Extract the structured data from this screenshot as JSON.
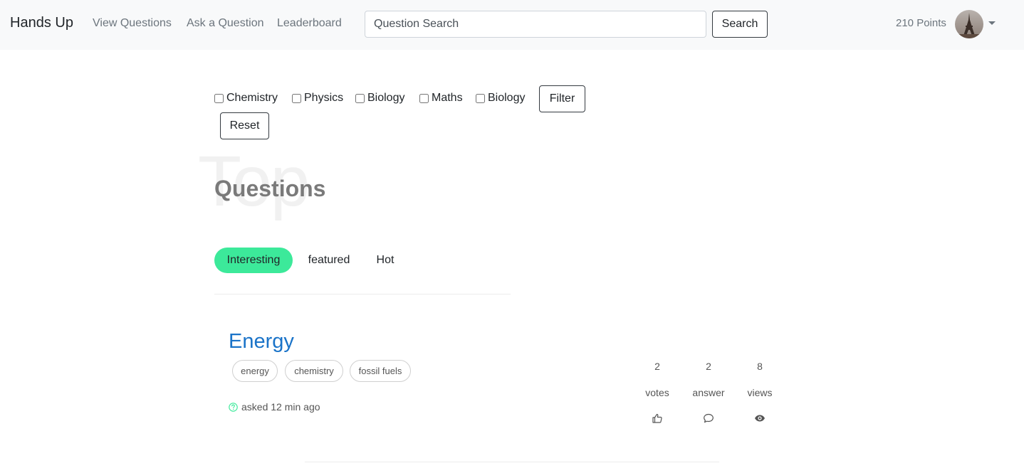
{
  "navbar": {
    "brand": "Hands Up",
    "links": [
      "View Questions",
      "Ask a Question",
      "Leaderboard"
    ],
    "search_placeholder": "Question Search",
    "search_button": "Search",
    "points": "210 Points"
  },
  "filters": {
    "subjects": [
      "Chemistry",
      "Physics",
      "Biology",
      "Maths",
      "Biology"
    ],
    "filter_button": "Filter",
    "reset_button": "Reset"
  },
  "heading": {
    "background_word": "Top",
    "title": "Questions"
  },
  "tabs": [
    {
      "label": "Interesting",
      "active": true
    },
    {
      "label": "featured",
      "active": false
    },
    {
      "label": "Hot",
      "active": false
    }
  ],
  "question": {
    "title": "Energy",
    "tags": [
      "energy",
      "chemistry",
      "fossil fuels"
    ],
    "asked": "asked 12 min ago",
    "stats": {
      "votes_count": "2",
      "votes_label": "votes",
      "answers_count": "2",
      "answers_label": "answer",
      "views_count": "8",
      "views_label": "views"
    }
  },
  "colors": {
    "accent": "#3ce99a",
    "link": "#1a73c8",
    "navbar_bg": "#f8f9fa"
  }
}
